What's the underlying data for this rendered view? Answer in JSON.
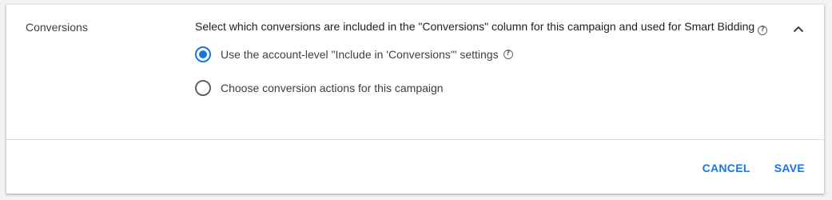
{
  "section": {
    "label": "Conversions",
    "description": "Select which conversions are included in the \"Conversions\" column for this campaign and used for Smart Bidding",
    "help_glyph": "?"
  },
  "options": [
    {
      "label": "Use the account-level \"Include in 'Conversions'\" settings",
      "selected": true,
      "has_help": true
    },
    {
      "label": "Choose conversion actions for this campaign",
      "selected": false,
      "has_help": false
    }
  ],
  "actions": {
    "cancel_label": "CANCEL",
    "save_label": "SAVE"
  },
  "colors": {
    "accent": "#1a73e8",
    "text": "#202124",
    "divider": "#dadce0"
  },
  "icons": {
    "collapse": "chevron-up-icon",
    "help": "help-circle-icon"
  }
}
